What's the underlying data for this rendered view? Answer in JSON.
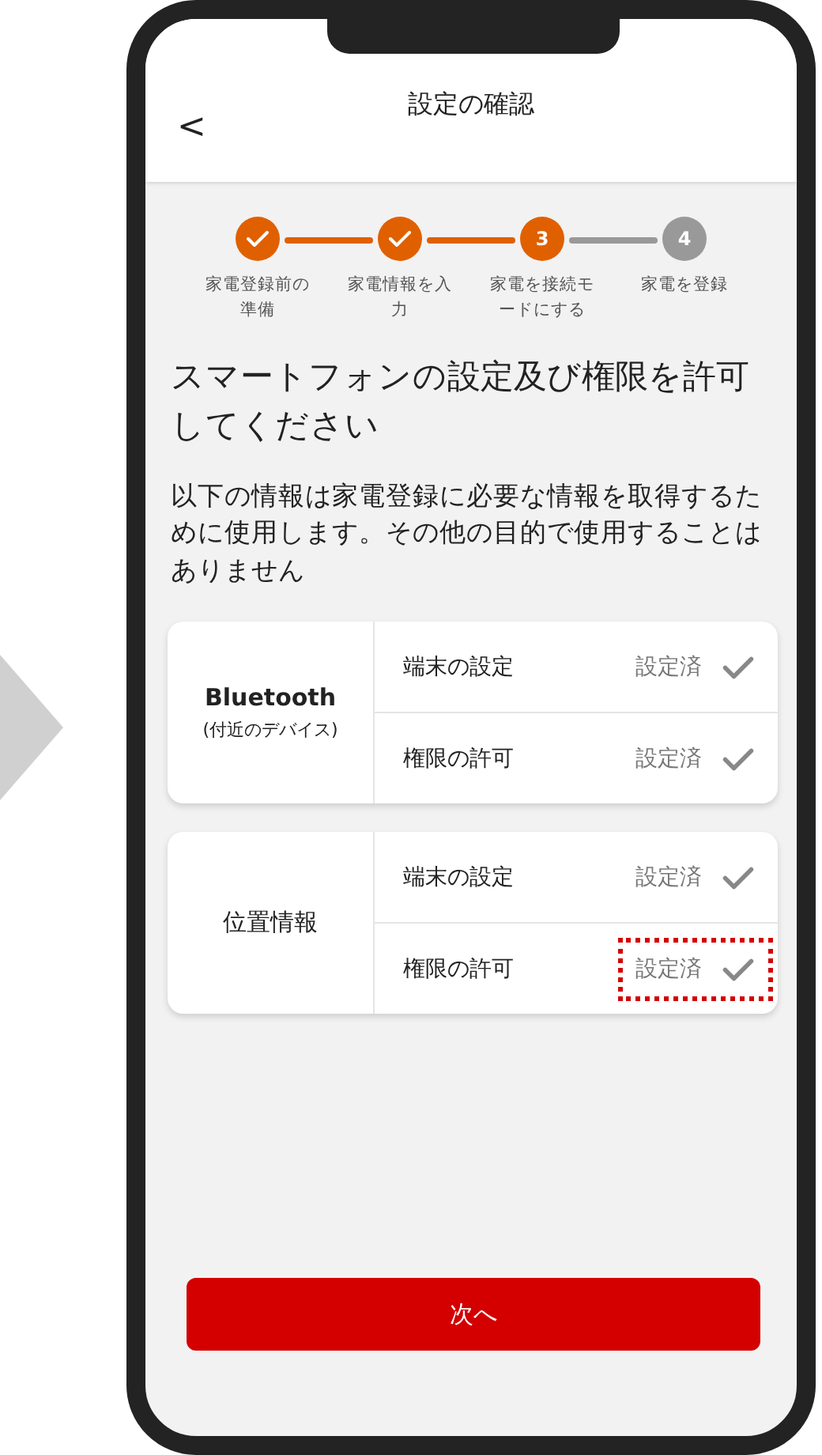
{
  "header": {
    "back": "<",
    "title": "設定の確認"
  },
  "steps": [
    {
      "label": "家電登録前の準備",
      "kind": "done"
    },
    {
      "label": "家電情報を入力",
      "kind": "done"
    },
    {
      "label": "家電を接続モードにする",
      "kind": "current",
      "number": "3"
    },
    {
      "label": "家電を登録",
      "kind": "upcoming",
      "number": "4"
    }
  ],
  "heading": "スマートフォンの設定及び権限を許可してください",
  "description": "以下の情報は家電登録に必要な情報を取得するために使用します。その他の目的で使用することはありません",
  "cards": [
    {
      "title": "Bluetooth",
      "subtitle": "(付近のデバイス)",
      "rows": [
        {
          "label": "端末の設定",
          "status": "設定済",
          "done": true,
          "highlighted": false
        },
        {
          "label": "権限の許可",
          "status": "設定済",
          "done": true,
          "highlighted": false
        }
      ]
    },
    {
      "title": "位置情報",
      "rows": [
        {
          "label": "端末の設定",
          "status": "設定済",
          "done": true,
          "highlighted": false
        },
        {
          "label": "権限の許可",
          "status": "設定済",
          "done": true,
          "highlighted": true
        }
      ]
    }
  ],
  "next_button": "次へ"
}
